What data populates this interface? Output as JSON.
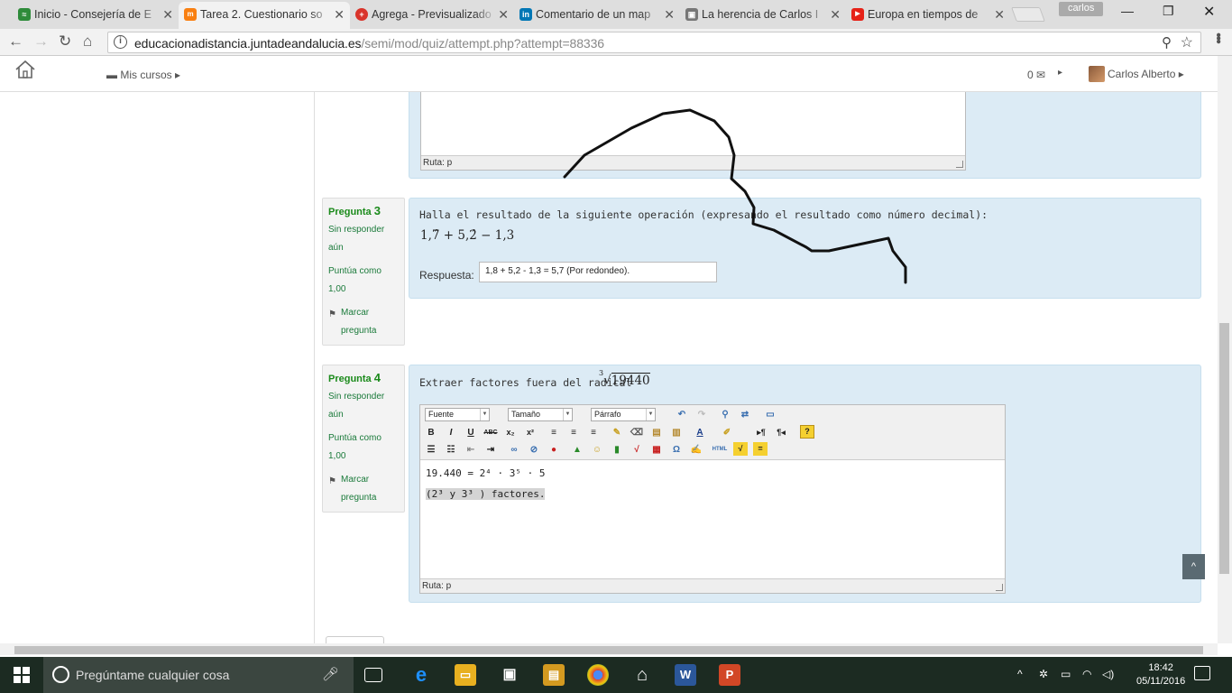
{
  "browser": {
    "tabs": [
      {
        "title": "Inicio - Consejería de E",
        "icon": "wifi-icon",
        "color": "#2e8b3a"
      },
      {
        "title": "Tarea 2. Cuestionario so",
        "icon": "moodle-icon",
        "color": "#f98012"
      },
      {
        "title": "Agrega - Previsualizado",
        "icon": "agrega-icon",
        "color": "#d9342b"
      },
      {
        "title": "Comentario de un map",
        "icon": "linkedin-icon",
        "color": "#0077b5"
      },
      {
        "title": "La herencia de Carlos I",
        "icon": "image-icon",
        "color": "#777777"
      },
      {
        "title": "Europa en tiempos de",
        "icon": "youtube-icon",
        "color": "#e62117"
      }
    ],
    "profile_name": "carlos",
    "url_domain": "educacionadistancia.juntadeandalucia.es",
    "url_path": "/semi/mod/quiz/attempt.php?attempt=88336"
  },
  "moodle_nav": {
    "mis_cursos": "Mis cursos",
    "message_count": "0",
    "user_name": "Carlos Alberto"
  },
  "q2": {
    "ruta": "Ruta: p"
  },
  "q3": {
    "number_label": "Pregunta",
    "number": "3",
    "state": "Sin responder aún",
    "grade": "Puntúa como 1,00",
    "flag": "Marcar pregunta",
    "text": "Halla el resultado de la siguiente operación (expresando el resultado como número decimal):",
    "math": "1,7̂ + 5,2̂ − 1,3",
    "answer_label": "Respuesta:",
    "answer_value": "1,8 + 5,2 - 1,3 = 5,7 (Por redondeo)."
  },
  "q4": {
    "number_label": "Pregunta",
    "number": "4",
    "state": "Sin responder aún",
    "grade": "Puntúa como 1,00",
    "flag": "Marcar pregunta",
    "text": "Extraer factores fuera del radical",
    "radical_index": "3",
    "radicand": "19440",
    "editor": {
      "font_select": "Fuente",
      "size_select": "Tamaño",
      "format_select": "Párrafo",
      "line1": "19.440 = 2⁴ · 3⁵ · 5",
      "line2": "(2³ y 3³ ) factores.",
      "ruta": "Ruta: p"
    }
  },
  "back_to_top": "^",
  "taskbar": {
    "search_placeholder": "Pregúntame cualquier cosa",
    "time": "18:42",
    "date": "05/11/2016"
  }
}
